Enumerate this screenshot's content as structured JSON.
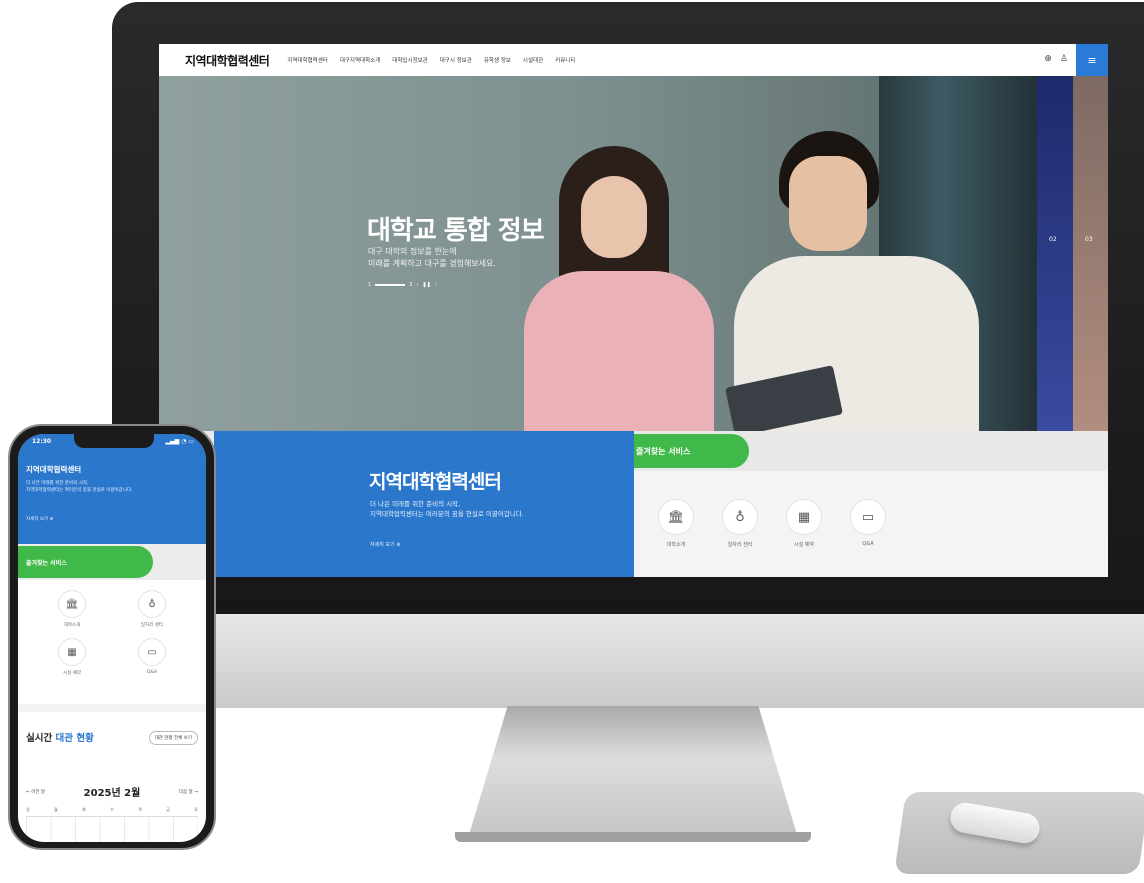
{
  "desktop": {
    "logo": "지역대학협력센터",
    "menu": [
      "지역대학협력센터",
      "대구지역대학소개",
      "대학입시정보관",
      "대구시 정보관",
      "유학생 정보",
      "시설대관",
      "커뮤니티"
    ],
    "nav_icons": [
      "globe-icon",
      "user-icon"
    ],
    "hero": {
      "title": "대학교 통합 정보",
      "subtitle_line1": "대구 대학의 정보를 한눈에",
      "subtitle_line2": "미래를 계획하고 대구를 경험해보세요.",
      "pager_current": "1",
      "pager_total": "3",
      "side_num_1": "02",
      "side_num_2": "03"
    },
    "center": {
      "title": "지역대학협력센터",
      "desc_line1": "더 나은 미래를 위한 준비의 시작,",
      "desc_line2": "지역대학협력센터는 여러분의 꿈을 현실로 이끌어갑니다.",
      "more": "자세히 보기"
    },
    "favorites": {
      "title": "즐겨찾는 서비스",
      "items": [
        {
          "label": "대학소개",
          "icon": "university-icon"
        },
        {
          "label": "일자리 센터",
          "icon": "lightbulb-icon"
        },
        {
          "label": "시설 예약",
          "icon": "calendar-icon"
        },
        {
          "label": "Q&A",
          "icon": "chat-icon"
        }
      ]
    }
  },
  "mobile": {
    "time": "12:30",
    "status": "signal-wifi-battery-icons",
    "title": "지역대학협력센터",
    "desc_line1": "더 나은 미래를 위한 준비의 시작,",
    "desc_line2": "지역대학협력센터는 여러분의 꿈을 현실로 이끌어갑니다.",
    "more": "자세히 보기",
    "fav_title": "즐겨찾는 서비스",
    "fav_items": [
      "대학소개",
      "일자리 센터",
      "시설 예약",
      "Q&A"
    ],
    "rt_title_a": "실시간",
    "rt_title_b": "대관 현황",
    "rt_button": "대관 현황 전체 보기",
    "cal_prev": "← 이전 달",
    "cal_month": "2025년 2월",
    "cal_next": "다음 달 →",
    "weekdays": [
      "일",
      "월",
      "화",
      "수",
      "목",
      "금",
      "토"
    ]
  }
}
